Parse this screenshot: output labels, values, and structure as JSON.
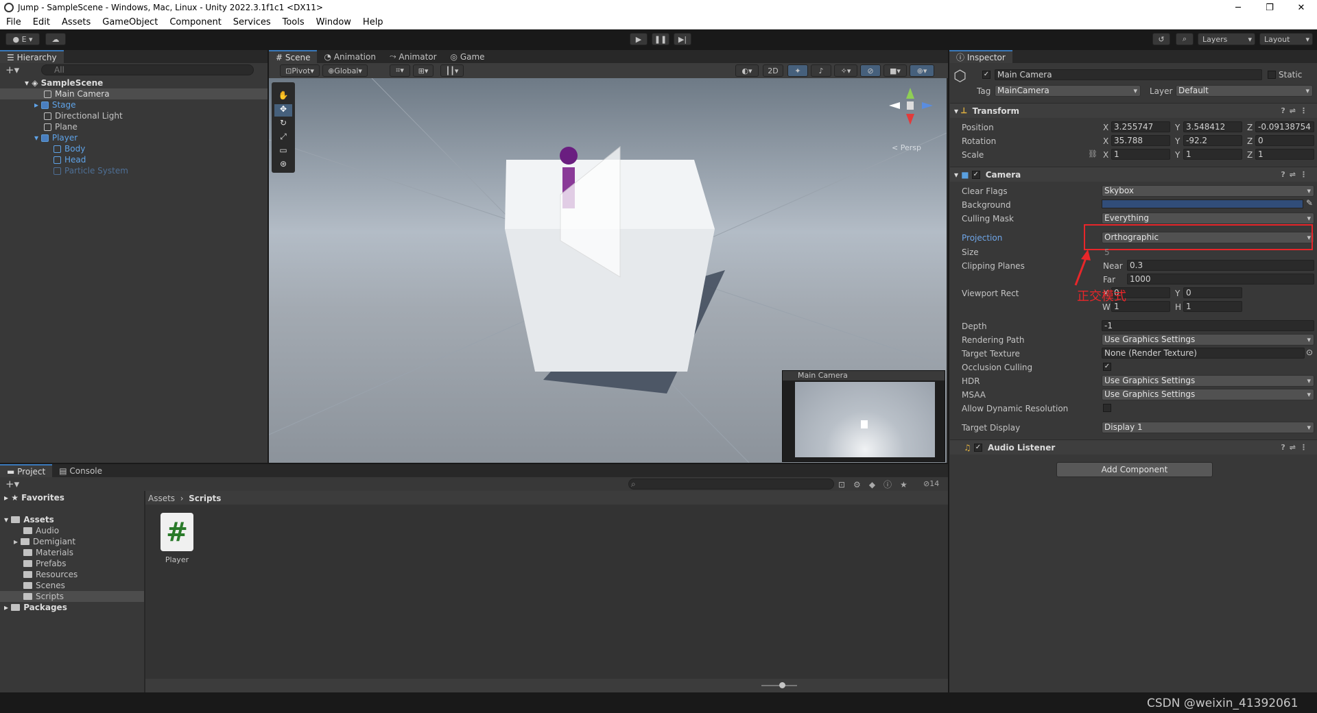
{
  "window": {
    "title": "Jump - SampleScene - Windows, Mac, Linux - Unity 2022.3.1f1c1 <DX11>",
    "min": "─",
    "max": "❐",
    "close": "✕"
  },
  "menu": [
    "File",
    "Edit",
    "Assets",
    "GameObject",
    "Component",
    "Services",
    "Tools",
    "Window",
    "Help"
  ],
  "toolbar": {
    "account": "E",
    "layers": "Layers",
    "layout": "Layout"
  },
  "hierarchy": {
    "tab": "Hierarchy",
    "search_placeholder": "All",
    "scene": "SampleScene",
    "items": [
      "Main Camera",
      "Stage",
      "Directional Light",
      "Plane",
      "Player",
      "Body",
      "Head",
      "Particle System"
    ]
  },
  "scene_tabs": [
    "Scene",
    "Animation",
    "Animator",
    "Game"
  ],
  "scene_toolbar": {
    "pivot": "Pivot",
    "global": "Global",
    "mode2d": "2D",
    "persp": "< Persp"
  },
  "camera_preview": {
    "title": "Main Camera"
  },
  "project": {
    "tabs": [
      "Project",
      "Console"
    ],
    "favorites": "Favorites",
    "assets": "Assets",
    "folders": [
      "Audio",
      "Demigiant",
      "Materials",
      "Prefabs",
      "Resources",
      "Scenes",
      "Scripts"
    ],
    "packages": "Packages",
    "breadcrumb": [
      "Assets",
      "Scripts"
    ],
    "file": "Player",
    "file_icon": "#",
    "hidden_count": "14"
  },
  "inspector": {
    "tab": "Inspector",
    "object_name": "Main Camera",
    "static_label": "Static",
    "tag_label": "Tag",
    "tag": "MainCamera",
    "layer_label": "Layer",
    "layer": "Default",
    "transform": {
      "title": "Transform",
      "position_label": "Position",
      "rotation_label": "Rotation",
      "scale_label": "Scale",
      "position": [
        "3.255747",
        "3.548412",
        "-0.09138754"
      ],
      "rotation": [
        "35.788",
        "-92.2",
        "0"
      ],
      "scale": [
        "1",
        "1",
        "1"
      ]
    },
    "camera": {
      "title": "Camera",
      "clear_flags_label": "Clear Flags",
      "clear_flags": "Skybox",
      "background_label": "Background",
      "culling_mask_label": "Culling Mask",
      "culling_mask": "Everything",
      "projection_label": "Projection",
      "projection": "Orthographic",
      "size_label": "Size",
      "size": "5",
      "clipping_label": "Clipping Planes",
      "near_label": "Near",
      "near": "0.3",
      "far_label": "Far",
      "far": "1000",
      "viewport_label": "Viewport Rect",
      "vx": "0",
      "vy": "0",
      "vw": "1",
      "vh": "1",
      "depth_label": "Depth",
      "depth": "-1",
      "rendering_path_label": "Rendering Path",
      "rendering_path": "Use Graphics Settings",
      "target_texture_label": "Target Texture",
      "target_texture": "None (Render Texture)",
      "occlusion_label": "Occlusion Culling",
      "hdr_label": "HDR",
      "hdr": "Use Graphics Settings",
      "msaa_label": "MSAA",
      "msaa": "Use Graphics Settings",
      "dynres_label": "Allow Dynamic Resolution",
      "target_display_label": "Target Display",
      "target_display": "Display 1"
    },
    "audio": {
      "title": "Audio Listener"
    },
    "add_component": "Add Component"
  },
  "annotation": {
    "text": "正交模式",
    "color": "#e8262a"
  },
  "watermark": "CSDN @weixin_41392061",
  "axes": {
    "x": "X",
    "y": "Y",
    "z": "Z",
    "w": "W",
    "h": "H"
  },
  "colors": {
    "accent": "#3a79bb",
    "annotation": "#e8262a",
    "background_swatch": "#314d79"
  }
}
